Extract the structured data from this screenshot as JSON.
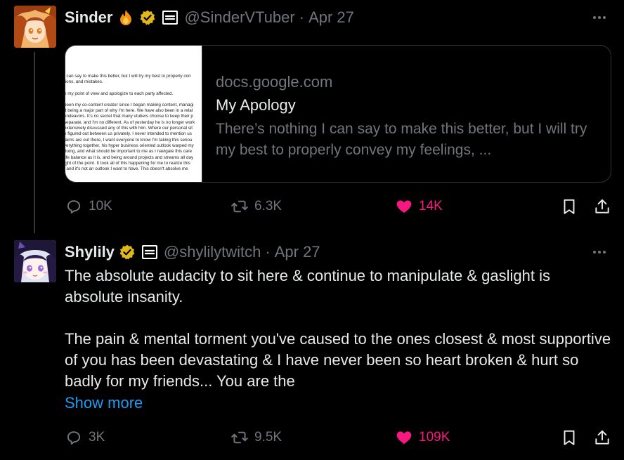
{
  "posts": [
    {
      "author": "Sinder",
      "handle": "@SinderVTuber",
      "separator": "·",
      "date": "Apr 27",
      "link_card": {
        "domain": "docs.google.com",
        "title": "My Apology",
        "description": "There’s nothing I can say to make this better, but I will try my best to properly convey my feelings, ...",
        "thumbnail_lines": [
          "I can say to make this better, but I will try my best to properly con",
          "tions, and mistakes.",
          "",
          "n my point of view and apologize to each party affected.",
          "",
          "been my co-content creator since I began making content, managi",
          "d being a major part of why I'm here. We have also been in a relat",
          "endeavors. It's no secret that many vtubers choose to keep their p",
          "separate, and I'm no different. As of yesterday he is no longer work",
          "extensively discussed any of this with him. Where our personal sit",
          "e figured out between us privately. I never intended to mention us",
          "laims are out there, I want everyone to know I'm taking this seriou",
          "verything together, his hyper business oriented outlook warped my",
          " doing, and what should be important to me as I navigate this care",
          "life balance as it is, and being around projects and streams all day",
          "ight of the point. It took all of this happening for me to realize this",
          ", and it's not an outlook I want to have. This doesn't absolve me"
        ]
      },
      "stats": {
        "replies": "10K",
        "reposts": "6.3K",
        "likes": "14K"
      },
      "liked": true
    },
    {
      "author": "Shylily",
      "handle": "@shylilytwitch",
      "separator": "·",
      "date": "Apr 27",
      "paragraphs": [
        "The absolute audacity to sit here & continue to manipulate & gaslight is absolute insanity.",
        "The pain & mental torment you've caused to the ones closest & most supportive of you has been devastating & I have never been so heart broken & hurt so badly for my friends... You are the"
      ],
      "show_more": "Show more",
      "stats": {
        "replies": "3K",
        "reposts": "9.5K",
        "likes": "109K"
      },
      "liked": true
    }
  ],
  "icons": {
    "verified": "verified-badge-icon",
    "flame": "fire-emoji-icon",
    "subscriber": "subscription-badge-icon",
    "reply": "reply-icon",
    "repost": "repost-icon",
    "like": "heart-icon",
    "bookmark": "bookmark-icon",
    "share": "share-icon",
    "more": "more-options-icon"
  },
  "colors": {
    "background": "#000000",
    "text": "#e7e9ea",
    "muted": "#71767b",
    "like": "#f91880",
    "link": "#1d9bf0",
    "verified": "#e2b719",
    "border": "#2f3336"
  }
}
